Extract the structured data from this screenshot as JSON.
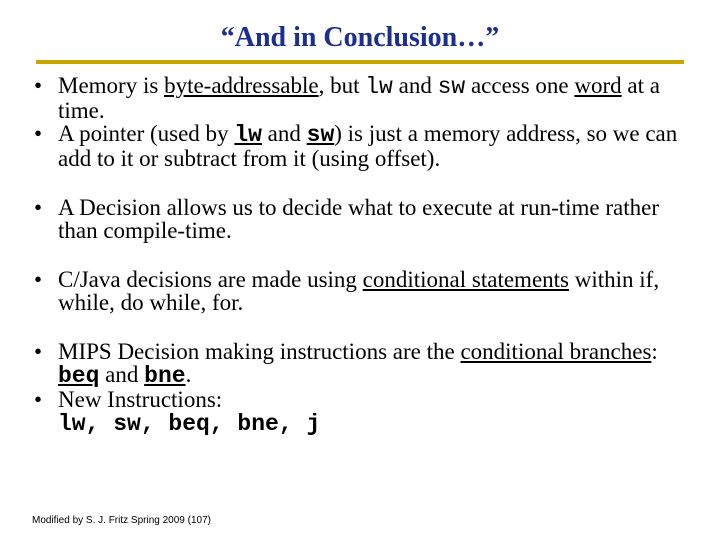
{
  "title": "“And in Conclusion…”",
  "b1": {
    "p1": "Memory is ",
    "u1": "byte-addressable",
    "p2": ", but ",
    "c1": "lw",
    "p3": " and ",
    "c2": "sw",
    "p4": " access one ",
    "u2": "word",
    "p5": " at a time."
  },
  "b2": {
    "p1": "A pointer (used by ",
    "c1": "lw",
    "p2": " and ",
    "c2": "sw",
    "p3": ") is just a memory address, so we can add to it or subtract from it (using offset)."
  },
  "b3": "A Decision allows us to decide what to execute at run-time rather than compile-time.",
  "b4": {
    "p1": "C/Java decisions are made using ",
    "u1": "conditional statements",
    "p2": " within if, while, do while, for."
  },
  "b5": {
    "p1": "MIPS Decision making instructions are the ",
    "u1": "conditional branches",
    "p2": ": ",
    "c1": "beq",
    "p3": " and ",
    "c2": "bne",
    "p4": "."
  },
  "b6": {
    "p1": "New Instructions:",
    "code": "lw, sw, beq, bne, j"
  },
  "footer": "Modified by S. J. Fritz  Spring 2009 (107)"
}
